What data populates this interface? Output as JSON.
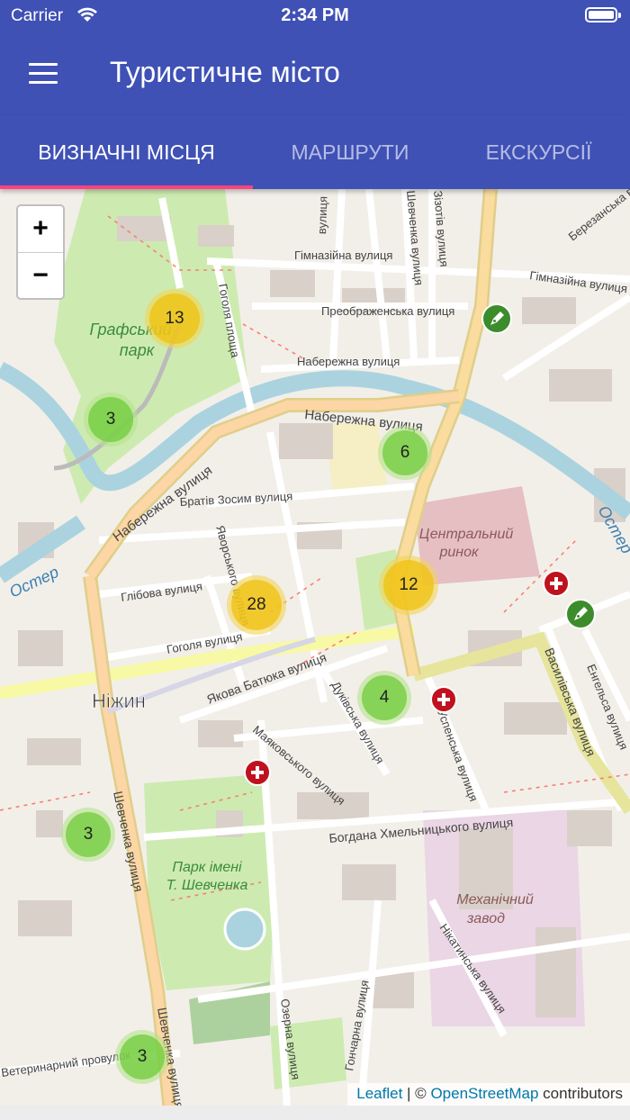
{
  "status_bar": {
    "carrier": "Carrier",
    "time": "2:34 PM"
  },
  "app_bar": {
    "title": "Туристичне місто",
    "menu_icon": "hamburger-menu-icon"
  },
  "tabs": [
    {
      "label": "ВИЗНАЧНІ МІСЦЯ",
      "selected": true
    },
    {
      "label": "МАРШРУТИ",
      "selected": false
    },
    {
      "label": "ЕКСКУРСІЇ",
      "selected": false
    }
  ],
  "colors": {
    "primary": "#3f51b5",
    "tab_indicator": "#ff4081",
    "cluster_small": "#6ecc39",
    "cluster_medium": "#f0c20c",
    "medical_poi": "#c0121e",
    "art_poi": "#3d8c2c"
  },
  "map": {
    "zoom_in": "+",
    "zoom_out": "−",
    "clusters": [
      {
        "count": "13",
        "size": "medium"
      },
      {
        "count": "3",
        "size": "small"
      },
      {
        "count": "6",
        "size": "small"
      },
      {
        "count": "12",
        "size": "medium"
      },
      {
        "count": "28",
        "size": "medium"
      },
      {
        "count": "4",
        "size": "small"
      },
      {
        "count": "3",
        "size": "small"
      },
      {
        "count": "3",
        "size": "small"
      }
    ],
    "labels": {
      "city": "Ніжин",
      "graf_park_1": "Графський",
      "graf_park_2": "парк",
      "shev_park_1": "Парк імені",
      "shev_park_2": "Т. Шевченка",
      "market_1": "Центральний",
      "market_2": "ринок",
      "factory_1": "Механічний",
      "factory_2": "завод",
      "river": "Остер",
      "river2": "Остер",
      "st_gymn": "Гімназійна вулиця",
      "st_gymn2": "Гімназійна вулиця",
      "st_preobr": "Преображенська вулиця",
      "st_nab_small": "Набережна вулиця",
      "st_nab_main": "Набережна вулиця",
      "st_nab_west": "Набережна вулиця",
      "st_gogol_sq": "Гоголя площа",
      "st_zosym": "Братів Зосим вулиця",
      "st_hlib": "Глібова вулиця",
      "st_yavor": "Яворського вулиця",
      "st_gogol": "Гоголя вулиця",
      "st_batiuk": "Якова Батюка вулиця",
      "st_duk": "Дуківська вулиця",
      "st_mayak": "Маяковського вулиця",
      "st_uspen": "Успенська вулиця",
      "st_vasyl": "Василівська вулиця",
      "st_engel": "Енгельса вулиця",
      "st_khmel": "Богдана Хмельницького вулиця",
      "st_shev": "Шевченка вулиця",
      "st_shev2": "Шевченка вулиця",
      "st_ozerna": "Озерна вулиця",
      "st_honch": "Гончарна вулиця",
      "st_nikat": "Нікатинська вулиця",
      "st_vet": "Ветеринарний провулок",
      "st_berez": "Березанська вулиця",
      "st_top1": "вулиця",
      "st_top2": "Шевченка вулиця",
      "st_top3": "Зізотів вулиця"
    },
    "attribution": {
      "leaflet": "Leaflet",
      "sep": " | © ",
      "osm": "OpenStreetMap",
      "suffix": " contributors"
    }
  }
}
